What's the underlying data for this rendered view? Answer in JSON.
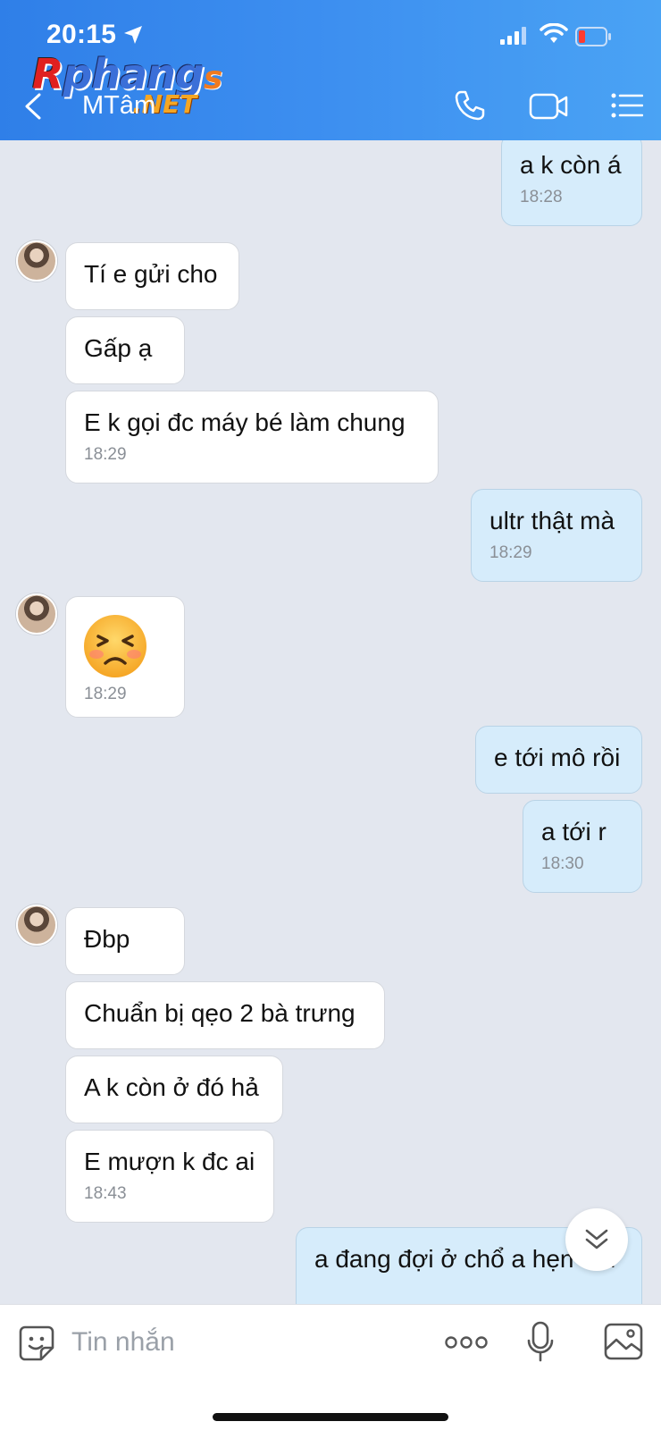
{
  "status_bar": {
    "time": "20:15"
  },
  "watermark": {
    "r": "R",
    "main": "phang",
    "s": "s",
    "net": ".NET"
  },
  "header": {
    "contact_name": "MTâm"
  },
  "messages": [
    {
      "side": "out",
      "text": "a k còn á",
      "time": "18:28"
    },
    {
      "side": "in",
      "text": "Tí e gửi cho"
    },
    {
      "side": "in",
      "text": "Gấp ạ"
    },
    {
      "side": "in",
      "text": "E k gọi đc máy bé làm chung",
      "time": "18:29"
    },
    {
      "side": "out",
      "text": "ultr thật mà",
      "time": "18:29"
    },
    {
      "side": "in",
      "emoji": "persevering-face",
      "time": "18:29"
    },
    {
      "side": "out",
      "text": "e tới mô rồi"
    },
    {
      "side": "out",
      "text": "a tới r",
      "time": "18:30"
    },
    {
      "side": "in",
      "text": "Đbp"
    },
    {
      "side": "in",
      "text": "Chuẩn bị qẹo 2 bà trưng"
    },
    {
      "side": "in",
      "text": "A k còn ở đó hả"
    },
    {
      "side": "in",
      "text": "E mượn k đc ai",
      "time": "18:43"
    },
    {
      "side": "out",
      "text": "a đang đợi ở chổ a hẹn em"
    }
  ],
  "composer": {
    "placeholder": "Tin nhắn"
  },
  "icons": {
    "sticker": "sticker-icon",
    "more": "more-icon",
    "mic": "microphone-icon",
    "image": "image-icon",
    "call": "phone-icon",
    "video": "video-call-icon",
    "menu": "list-menu-icon",
    "back": "back-arrow-icon"
  },
  "colors": {
    "header_start": "#2f7fe8",
    "header_end": "#4aa3f4",
    "chat_bg": "#e3e7ef",
    "bubble_out": "#d6ecfb",
    "bubble_in": "#ffffff"
  }
}
